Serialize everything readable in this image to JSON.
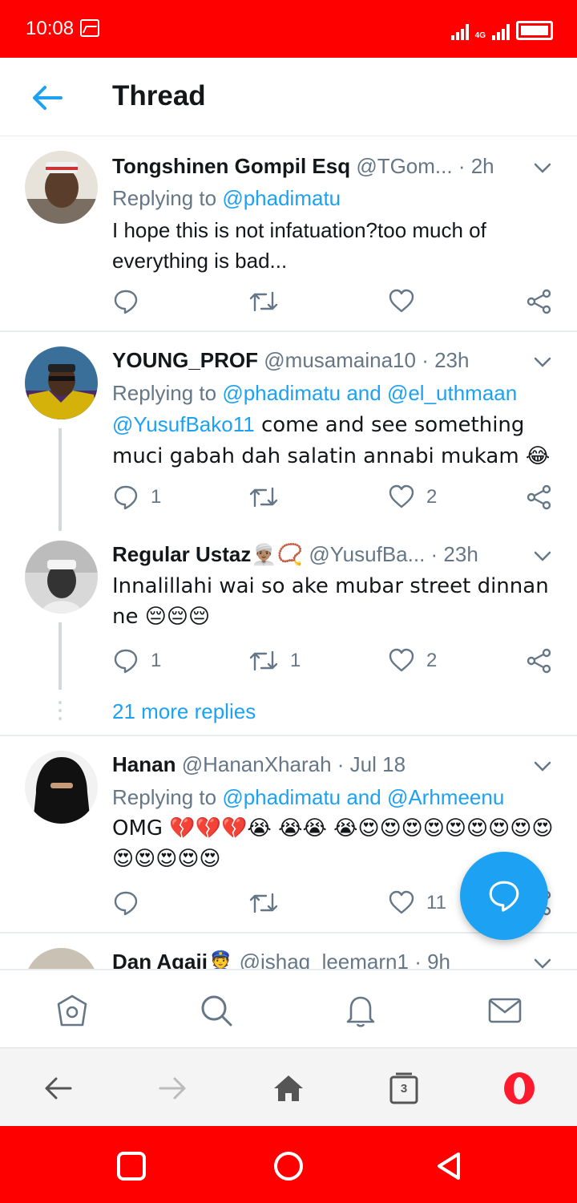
{
  "status_bar": {
    "time": "10:08",
    "network": "4G"
  },
  "header": {
    "title": "Thread"
  },
  "tweets": [
    {
      "name": "Tongshinen Gompil Esq",
      "handle": "@TGom...",
      "time": "· 2h",
      "reply_prefix": "Replying to ",
      "reply_to": "@phadimatu",
      "text": "I hope this is not infatuation?too much of everything is bad...",
      "replies": "",
      "retweets": "",
      "likes": ""
    },
    {
      "name": "YOUNG_PROF",
      "handle": "@musamaina10",
      "time": "· 23h",
      "reply_prefix": "Replying to ",
      "reply_to": "@phadimatu and @el_uthmaan",
      "mention": "@YusufBako11",
      "text": " come and see something muci gabah dah salatin annabi mukam 😂",
      "replies": "1",
      "retweets": "",
      "likes": "2"
    },
    {
      "name": "Regular Ustaz",
      "name_emoji": "👳🏽‍♂️📿",
      "handle": "@YusufBa...",
      "time": "· 23h",
      "text": "Innalillahi wai so ake mubar street dinnan ne 😔😔😔",
      "replies": "1",
      "retweets": "1",
      "likes": "2"
    },
    {
      "name": "Hanan",
      "handle": "@HananXharah",
      "time": "· Jul 18",
      "reply_prefix": "Replying to ",
      "reply_to": "@phadimatu and @Arhmeenu",
      "text": "OMG 💔💔💔😭 😭😭 😭😍😍😍😍😍😍😍😍😍😍😍😍😍😍",
      "replies": "",
      "retweets": "",
      "likes": "11"
    },
    {
      "name": "Dan Agaji",
      "name_emoji": "👮",
      "handle": "@ishaq_leemarn1",
      "time": "· 9h"
    }
  ],
  "more_replies": "21 more replies",
  "browser": {
    "tab_count": "3"
  },
  "colors": {
    "status_bar": "#ff0000",
    "accent": "#1da1f2",
    "muted": "#657786"
  }
}
